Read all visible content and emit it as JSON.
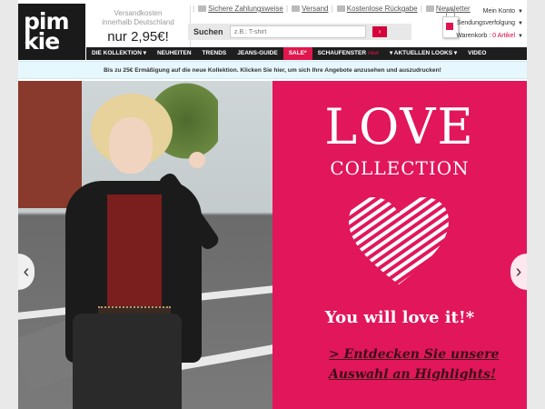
{
  "logo": {
    "line1": "pim",
    "line2": "kie",
    "registered": "®"
  },
  "shipping": {
    "line1": "Versandkosten",
    "line2": "innerhalb Deutschland",
    "price": "nur 2,95€!"
  },
  "toplinks": [
    "Sichere Zahlungsweise",
    "Versand",
    "Kostenlose Rückgabe",
    "Newsletter"
  ],
  "search": {
    "label": "Suchen",
    "placeholder": "z.B.: T-shirt",
    "go": "›"
  },
  "account": {
    "my_account": "Mein Konto",
    "tracking": "Sendungsverfolgung",
    "cart_label": "Warenkorb :",
    "cart_count": "0 Artikel"
  },
  "nav": {
    "items": [
      "DIE KOLLEKTION ▾",
      "NEUHEITEN",
      "TRENDS",
      "JEANS-GUIDE",
      "SALE*",
      "SCHAUFENSTER",
      "▾ AKTUELLEN LOOKS ▾",
      "VIDEO"
    ],
    "new_badge": "new"
  },
  "promo": "Bis zu 25€ Ermäßigung auf die neue Kollektion. Klicken Sie hier, um sich Ihre Angebote anzusehen und auszudrucken!",
  "hero": {
    "title": "LOVE",
    "subtitle": "COLLECTION",
    "tagline": "You will love it!*",
    "cta_line1": "> Entdecken Sie unsere",
    "cta_line2": "Auswahl an Highlights!",
    "prev": "‹",
    "next": "›",
    "accent": "#e2165a"
  },
  "colors": {
    "brand": "#1a1a1a",
    "sale": "#e0174d",
    "promo_bg": "#e6f7fd"
  }
}
